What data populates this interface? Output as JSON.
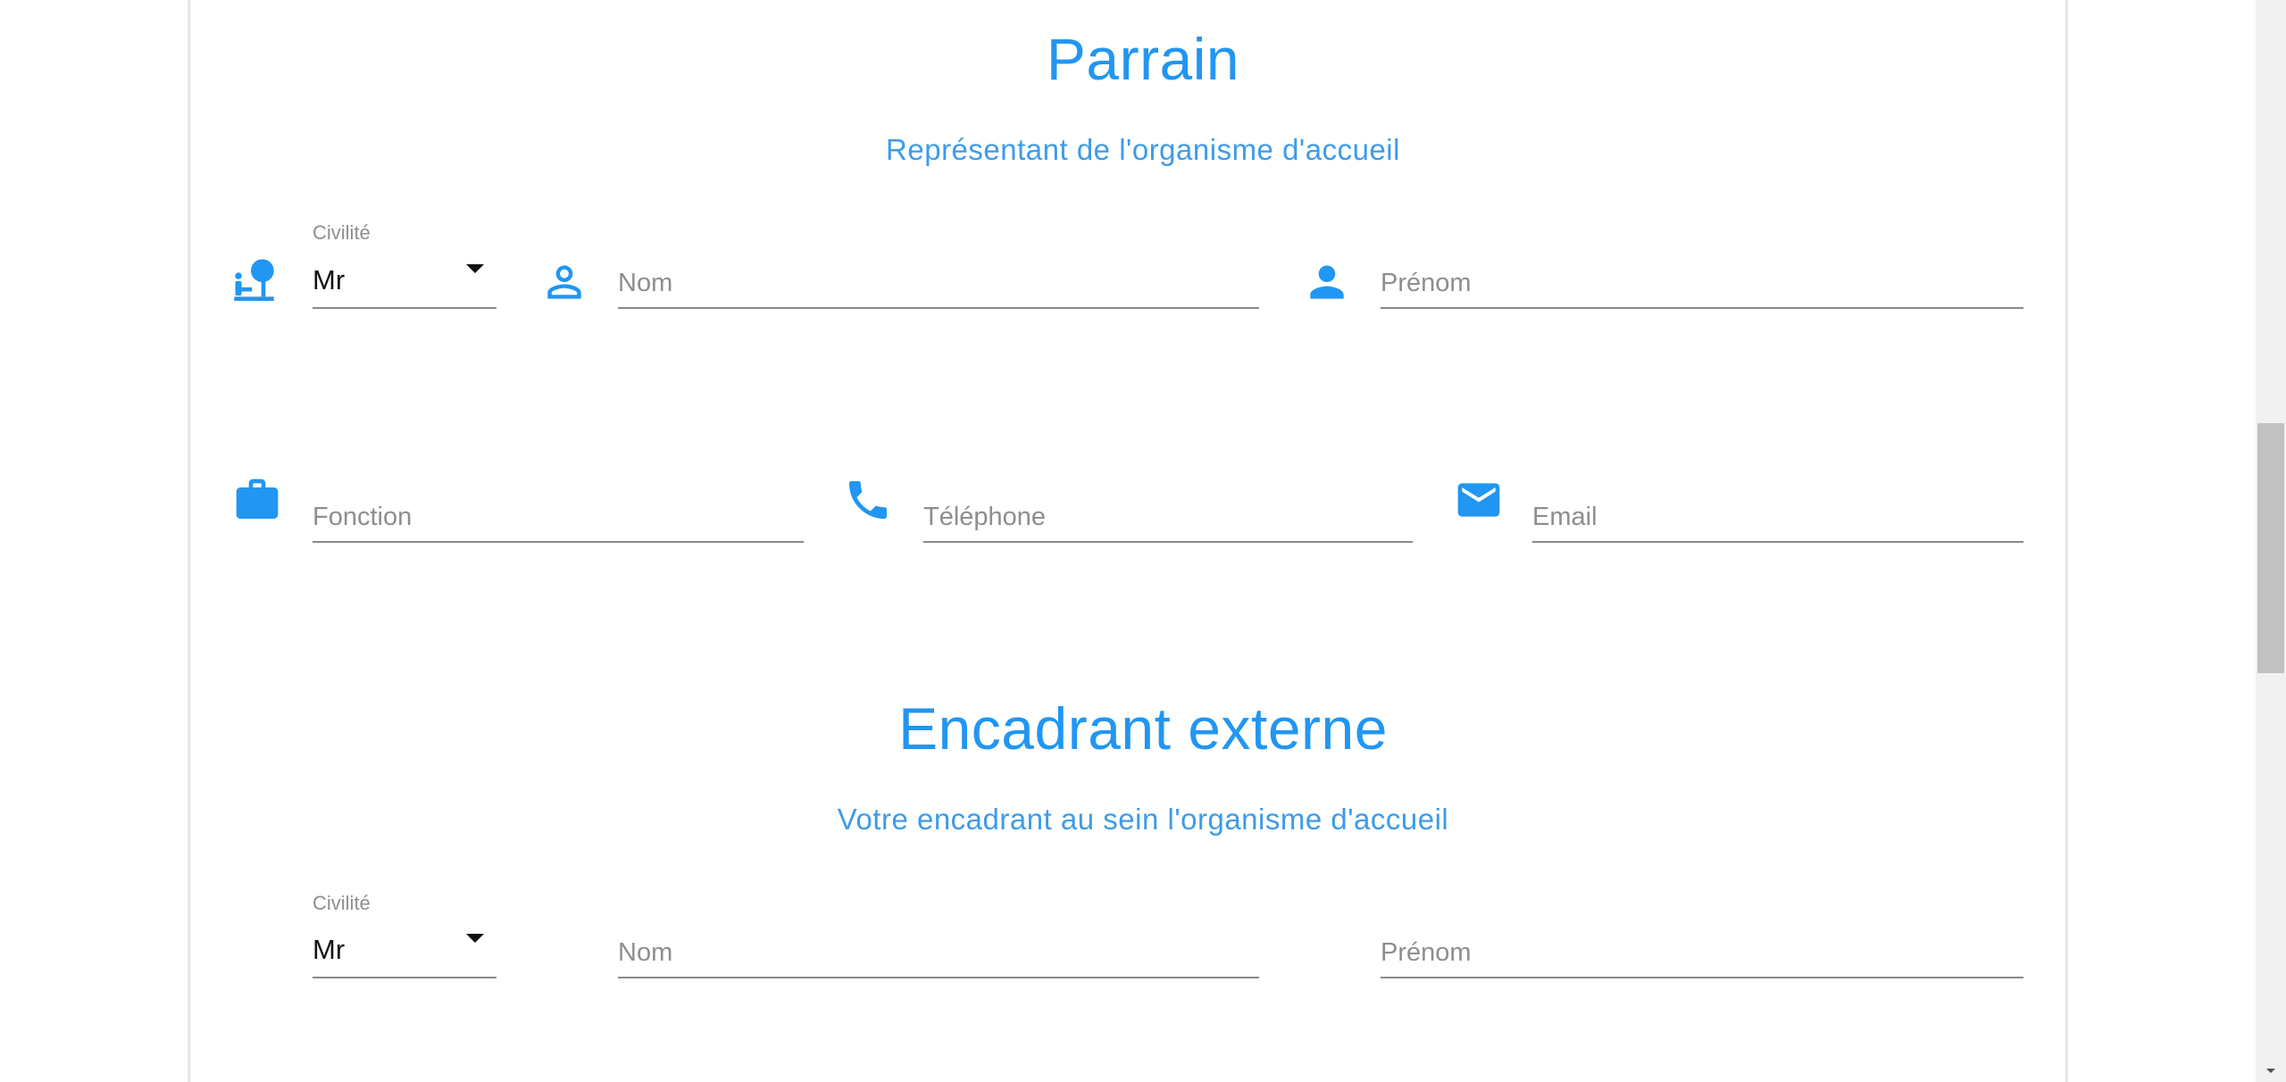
{
  "parrain": {
    "title": "Parrain",
    "subtitle": "Représentant de l'organisme d'accueil",
    "civilite_label": "Civilité",
    "civilite_value": "Mr",
    "nom_placeholder": "Nom",
    "prenom_placeholder": "Prénom",
    "fonction_placeholder": "Fonction",
    "telephone_placeholder": "Téléphone",
    "email_placeholder": "Email"
  },
  "encadrant": {
    "title": "Encadrant externe",
    "subtitle": "Votre encadrant au sein l'organisme d'accueil",
    "civilite_label": "Civilité",
    "civilite_value": "Mr",
    "nom_placeholder": "Nom",
    "prenom_placeholder": "Prénom"
  },
  "icons": {
    "civilite": "person-at-desk-icon",
    "nom": "person-outline-icon",
    "prenom": "person-icon",
    "fonction": "briefcase-icon",
    "telephone": "phone-icon",
    "email": "envelope-icon"
  },
  "colors": {
    "accent": "#2196f3",
    "field_underline": "#8a8a8a",
    "placeholder": "#8e8e8e"
  }
}
